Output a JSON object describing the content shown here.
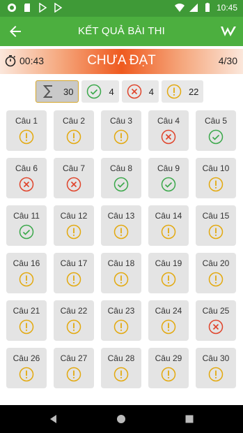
{
  "statusbar": {
    "time": "10:45"
  },
  "appbar": {
    "title": "KẾT QUẢ BÀI THI"
  },
  "result": {
    "timer": "00:43",
    "status": "CHƯA ĐẠT",
    "progress": "4/30"
  },
  "summary": [
    {
      "type": "total",
      "icon": "sigma-icon",
      "count": "30"
    },
    {
      "type": "correct",
      "icon": "check-circle-icon",
      "count": "4"
    },
    {
      "type": "wrong",
      "icon": "x-circle-icon",
      "count": "4"
    },
    {
      "type": "unanswered",
      "icon": "exclamation-circle-icon",
      "count": "22"
    }
  ],
  "questions": [
    {
      "label": "Câu 1",
      "state": "unanswered"
    },
    {
      "label": "Câu 2",
      "state": "unanswered"
    },
    {
      "label": "Câu 3",
      "state": "unanswered"
    },
    {
      "label": "Câu 4",
      "state": "wrong"
    },
    {
      "label": "Câu 5",
      "state": "correct"
    },
    {
      "label": "Câu 6",
      "state": "wrong"
    },
    {
      "label": "Câu 7",
      "state": "wrong"
    },
    {
      "label": "Câu 8",
      "state": "correct"
    },
    {
      "label": "Câu 9",
      "state": "correct"
    },
    {
      "label": "Câu 10",
      "state": "unanswered"
    },
    {
      "label": "Câu 11",
      "state": "correct"
    },
    {
      "label": "Câu 12",
      "state": "unanswered"
    },
    {
      "label": "Câu 13",
      "state": "unanswered"
    },
    {
      "label": "Câu 14",
      "state": "unanswered"
    },
    {
      "label": "Câu 15",
      "state": "unanswered"
    },
    {
      "label": "Câu 16",
      "state": "unanswered"
    },
    {
      "label": "Câu 17",
      "state": "unanswered"
    },
    {
      "label": "Câu 18",
      "state": "unanswered"
    },
    {
      "label": "Câu 19",
      "state": "unanswered"
    },
    {
      "label": "Câu 20",
      "state": "unanswered"
    },
    {
      "label": "Câu 21",
      "state": "unanswered"
    },
    {
      "label": "Câu 22",
      "state": "unanswered"
    },
    {
      "label": "Câu 23",
      "state": "unanswered"
    },
    {
      "label": "Câu 24",
      "state": "unanswered"
    },
    {
      "label": "Câu 25",
      "state": "wrong"
    },
    {
      "label": "Câu 26",
      "state": "unanswered"
    },
    {
      "label": "Câu 27",
      "state": "unanswered"
    },
    {
      "label": "Câu 28",
      "state": "unanswered"
    },
    {
      "label": "Câu 29",
      "state": "unanswered"
    },
    {
      "label": "Câu 30",
      "state": "unanswered"
    }
  ],
  "colors": {
    "appbar": "#4caf3f",
    "statusbar": "#3f9a37",
    "correct": "#3aa84a",
    "wrong": "#e0442b",
    "unanswered": "#e3a90e",
    "result_accent": "#ef5a1f"
  }
}
